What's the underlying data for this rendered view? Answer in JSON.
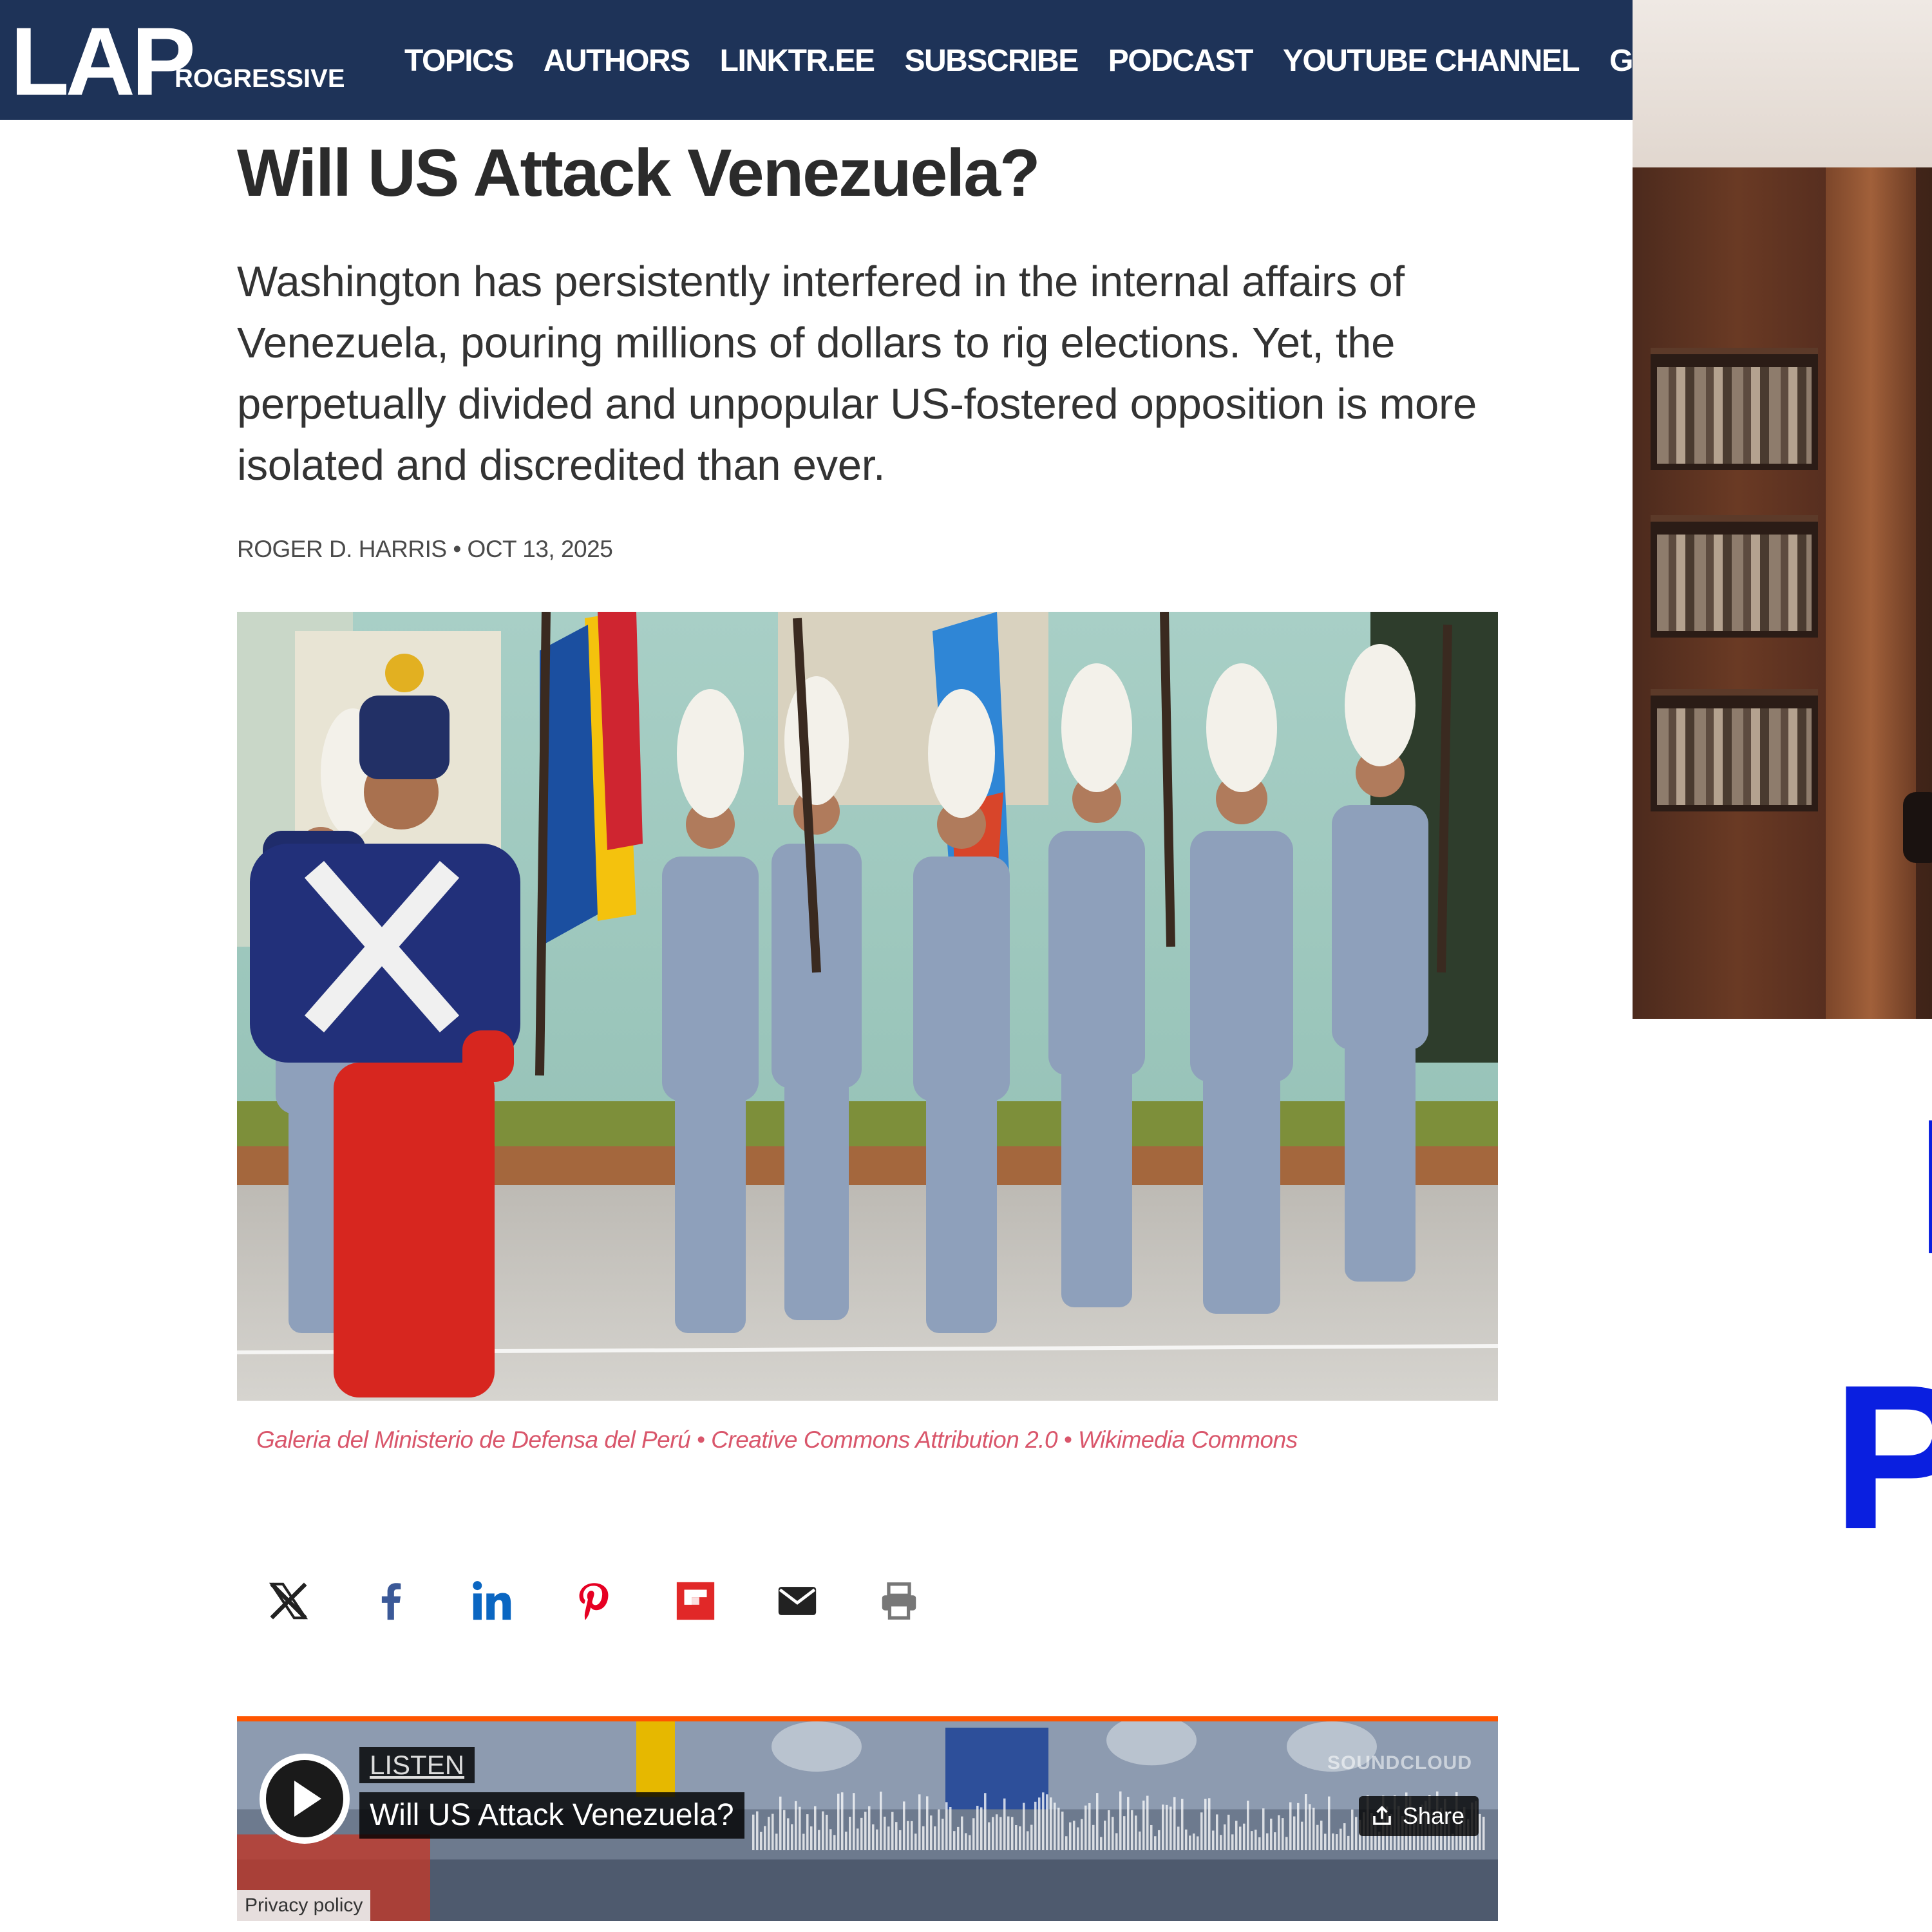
{
  "header": {
    "logo_main": "LAP",
    "logo_sub": "ROGRESSIVE",
    "nav": [
      "TOPICS",
      "AUTHORS",
      "LINKTR.EE",
      "SUBSCRIBE",
      "PODCAST",
      "YOUTUBE CHANNEL",
      "GLOSS"
    ]
  },
  "article": {
    "title": "Will US Attack Venezuela?",
    "dek": "Washington has persistently interfered in the internal affairs of Venezuela, pouring millions of dollars to rig elections. Yet, the perpetually divided and unpopular US-fostered opposition is more isolated and discredited than ever.",
    "byline": "ROGER D. HARRIS • OCT 13, 2025",
    "image_credit": "Galeria del Ministerio de Defensa del Perú • Creative Commons Attribution 2.0 • Wikimedia Commons"
  },
  "share": {
    "icons": [
      "x-icon",
      "facebook-icon",
      "linkedin-icon",
      "pinterest-icon",
      "flipboard-icon",
      "email-icon",
      "print-icon"
    ],
    "colors": {
      "x": "#222222",
      "facebook": "#3b5998",
      "linkedin": "#0a66c2",
      "pinterest": "#e60023",
      "flipboard": "#e12828",
      "email": "#222222",
      "print": "#777777"
    }
  },
  "player": {
    "listen_label": "LISTEN",
    "track_title": "Will US Attack Venezuela?",
    "brand": "SOUNDCLOUD",
    "share_label": "Share",
    "privacy_label": "Privacy policy",
    "accent": "#ff5500"
  },
  "side": {
    "letter1": "I",
    "letter2": "P"
  },
  "colors": {
    "header_bg": "#1e3358",
    "credit": "#d9566b",
    "side_letters": "#0a1fe0"
  }
}
